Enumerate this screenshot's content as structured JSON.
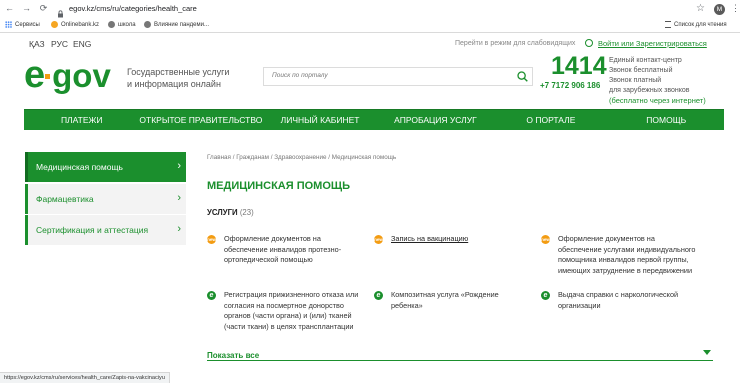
{
  "browser": {
    "url": "egov.kz/cms/ru/categories/health_care",
    "avatar": "M",
    "bookmarks": [
      "Сервисы",
      "Onlinebank.kz",
      "школа",
      "Влияние пандеми..."
    ],
    "reading_list": "Список для чтения",
    "status_url": "https://egov.kz/cms/ru/services/health_care/Zapis-na-vakcinaciyu"
  },
  "header": {
    "languages": [
      "ҚАЗ",
      "РУС",
      "ENG"
    ],
    "accessible_mode": "Перейти в режим для слабовидящих",
    "login": "Войти или Зарегистрироваться",
    "logo_e": "e",
    "logo_gov": "gov",
    "tagline_1": "Государственные услуги",
    "tagline_2": "и информация онлайн",
    "search_placeholder": "Поиск по порталу",
    "contact_number": "1414",
    "contact_lines": [
      "Единый контакт-центр",
      "Звонок бесплатный",
      "Звонок платный",
      "для зарубежных звонков"
    ],
    "contact_phone": "+7 7172 906 186",
    "contact_free_internet": "(бесплатно через интернет)"
  },
  "nav": [
    "ПЛАТЕЖИ",
    "ОТКРЫТОЕ ПРАВИТЕЛЬСТВО",
    "ЛИЧНЫЙ КАБИНЕТ",
    "АПРОБАЦИЯ УСЛУГ",
    "О ПОРТАЛЕ",
    "ПОМОЩЬ"
  ],
  "sidebar": [
    {
      "label": "Медицинская помощь",
      "active": true
    },
    {
      "label": "Фармацевтика",
      "active": false
    },
    {
      "label": "Сертификация и аттестация",
      "active": false
    }
  ],
  "breadcrumb": "Главная / Гражданам / Здравоохранение / Медицинская помощь",
  "page_title": "МЕДИЦИНСКАЯ ПОМОЩЬ",
  "services_heading": "УСЛУГИ",
  "services_count": "(23)",
  "services": [
    {
      "icon": "new",
      "lines": [
        "Оформление документов на",
        "обеспечение инвалидов протезно-",
        "ортопедической помощью"
      ]
    },
    {
      "icon": "new",
      "lines": [
        "Запись на вакцинацию"
      ],
      "underline": true
    },
    {
      "icon": "new",
      "lines": [
        "Оформление документов на",
        "обеспечение услугами индивидуального",
        "помощника инвалидов первой группы,",
        "имеющих затруднение в передвижении"
      ]
    },
    {
      "icon": "e",
      "lines": [
        "Регистрация прижизненного отказа или",
        "согласия на посмертное донорство",
        "органов (части органа) и (или) тканей",
        "(части ткани) в целях трансплантации"
      ]
    },
    {
      "icon": "e",
      "lines": [
        "Композитная услуга «Рождение",
        "ребенка»"
      ]
    },
    {
      "icon": "e",
      "lines": [
        "Выдача справки с наркологической",
        "организации"
      ]
    }
  ],
  "badge_new": "new",
  "badge_e": "e",
  "show_all": "Показать все",
  "colors": {
    "brand_green": "#1b8f2d",
    "new_badge": "#f39c12"
  }
}
